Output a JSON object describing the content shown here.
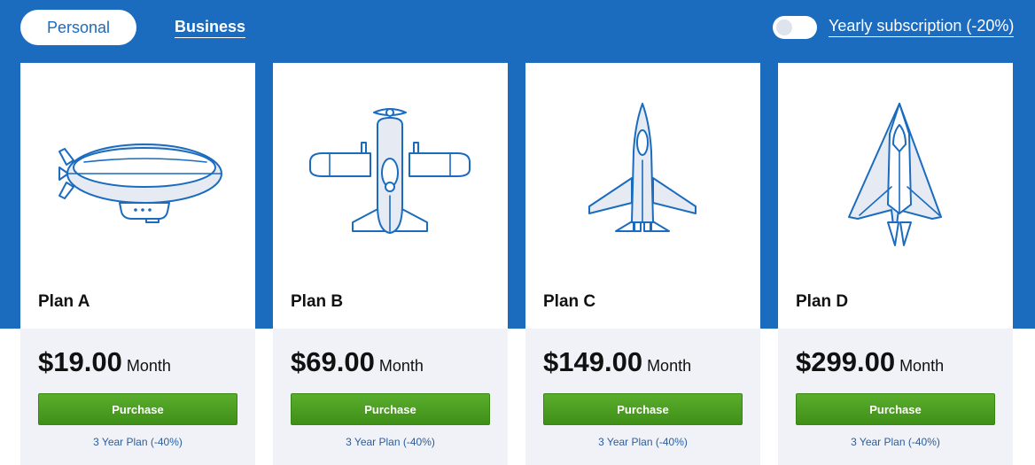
{
  "nav": {
    "personal_label": "Personal",
    "business_label": "Business",
    "yearly_label": "Yearly subscription (-20%)"
  },
  "plans": [
    {
      "name": "Plan A",
      "price": "$19.00",
      "period": "Month",
      "button": "Purchase",
      "alt": "3 Year Plan (-40%)",
      "icon": "airship-icon"
    },
    {
      "name": "Plan B",
      "price": "$69.00",
      "period": "Month",
      "button": "Purchase",
      "alt": "3 Year Plan (-40%)",
      "icon": "propeller-plane-icon"
    },
    {
      "name": "Plan C",
      "price": "$149.00",
      "period": "Month",
      "button": "Purchase",
      "alt": "3 Year Plan (-40%)",
      "icon": "fighter-jet-icon"
    },
    {
      "name": "Plan D",
      "price": "$299.00",
      "period": "Month",
      "button": "Purchase",
      "alt": "3 Year Plan (-40%)",
      "icon": "stealth-jet-icon"
    }
  ],
  "colors": {
    "brand_blue": "#1b6bbf",
    "button_green": "#4a9e20",
    "card_footer": "#f0f2f7"
  }
}
